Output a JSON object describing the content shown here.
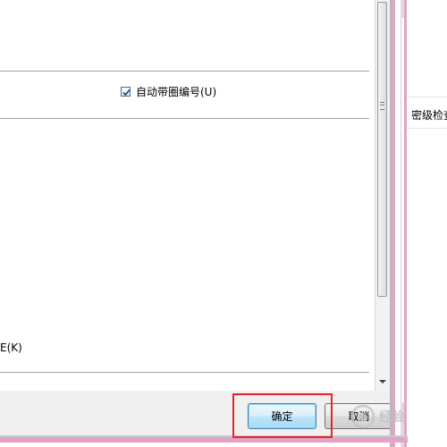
{
  "dialog": {
    "auto_circle_number_label": "自动带圈编号(U)",
    "auto_circle_number_checked": true,
    "partial_label": "E(K)"
  },
  "footer": {
    "ok_label": "确定",
    "cancel_label": "取消"
  },
  "side_panel": {
    "tab_label": "密级检查"
  },
  "watermark": {
    "text": "经验"
  },
  "colors": {
    "window_border": "#e6a2c6",
    "highlight": "#e8232d",
    "ok_button_border": "#3c7fb1"
  }
}
